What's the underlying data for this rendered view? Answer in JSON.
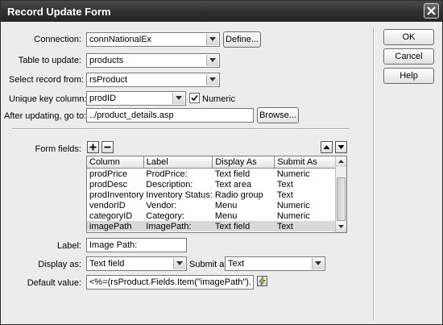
{
  "window": {
    "title": "Record Update Form"
  },
  "connection": {
    "label": "Connection:",
    "value": "connNationalEx",
    "define_label": "Define..."
  },
  "table": {
    "label": "Table to update:",
    "value": "products"
  },
  "select_record": {
    "label": "Select record from:",
    "value": "rsProduct"
  },
  "unique_key": {
    "label": "Unique key column:",
    "value": "prodID",
    "numeric_label": "Numeric",
    "numeric_checked": true
  },
  "after_update": {
    "label": "After updating, go to:",
    "value": "../product_details.asp",
    "browse_label": "Browse..."
  },
  "buttons": {
    "ok": "OK",
    "cancel": "Cancel",
    "help": "Help"
  },
  "form_fields": {
    "label": "Form fields:",
    "columns": [
      "Column",
      "Label",
      "Display As",
      "Submit As"
    ],
    "rows": [
      [
        "prodPrice",
        "ProdPrice:",
        "Text field",
        "Numeric"
      ],
      [
        "prodDesc",
        "Description:",
        "Text area",
        "Text"
      ],
      [
        "prodInventory",
        "Inventory Status:",
        "Radio group",
        "Text"
      ],
      [
        "vendorID",
        "Vendor:",
        "Menu",
        "Numeric"
      ],
      [
        "categoryID",
        "Category:",
        "Menu",
        "Numeric"
      ],
      [
        "imagePath",
        "ImagePath:",
        "Text field",
        "Text"
      ]
    ],
    "selected_row": 5
  },
  "field_label": {
    "label": "Label:",
    "value": "Image Path:"
  },
  "display_as": {
    "label": "Display as:",
    "value": "Text field"
  },
  "submit_as": {
    "label": "Submit as:",
    "value": "Text"
  },
  "default_value": {
    "label": "Default value:",
    "value": "<%=(rsProduct.Fields.Item(\"imagePath\").Value)%>"
  }
}
